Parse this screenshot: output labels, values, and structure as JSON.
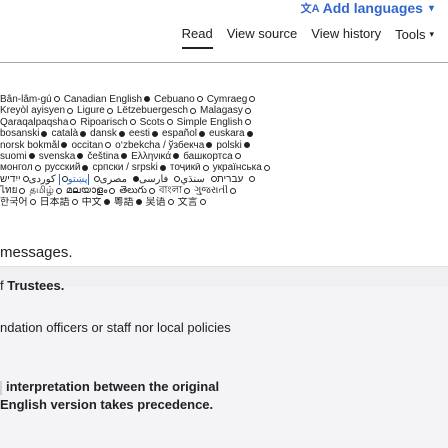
{
  "header": {
    "add_languages": "Add languages",
    "tabs": [
      {
        "label": "Read",
        "active": true
      },
      {
        "label": "View source",
        "active": false
      },
      {
        "label": "View history",
        "active": false
      },
      {
        "label": "Tools",
        "active": false
      }
    ]
  },
  "languages_rows": [
    [
      {
        "name": "Bân-lâm-gú",
        "dot": "open"
      },
      {
        "name": "Canadian English",
        "dot": "filled"
      },
      {
        "name": "Cebuano",
        "dot": "open"
      },
      {
        "name": "Cymraeg",
        "dot": "open"
      }
    ],
    [
      {
        "name": "Kreyòl ayisyen",
        "dot": "open"
      },
      {
        "name": "Ligure",
        "dot": "open"
      },
      {
        "name": "Lëtzebuergesch",
        "dot": "open"
      },
      {
        "name": "Malagasy",
        "dot": "open"
      }
    ],
    [
      {
        "name": "Qaraqalpaqsha",
        "dot": "open"
      },
      {
        "name": "Ripoarisch",
        "dot": "open"
      },
      {
        "name": "Scots",
        "dot": "open"
      },
      {
        "name": "Simple English",
        "dot": "open"
      }
    ],
    [
      {
        "name": "bosanski",
        "dot": "filled"
      },
      {
        "name": "català",
        "dot": "filled"
      },
      {
        "name": "dansk",
        "dot": "filled"
      },
      {
        "name": "eesti",
        "dot": "filled"
      },
      {
        "name": "español",
        "dot": "filled"
      },
      {
        "name": "euskara",
        "dot": "filled"
      }
    ],
    [
      {
        "name": "norsk bokmål",
        "dot": "filled"
      },
      {
        "name": "occitan",
        "dot": "open"
      },
      {
        "name": "o‘zbekcha / ўзбекча",
        "dot": "filled"
      },
      {
        "name": "polski",
        "dot": "filled"
      }
    ],
    [
      {
        "name": "suomi",
        "dot": "filled"
      },
      {
        "name": "svenska",
        "dot": "filled"
      },
      {
        "name": "čeština",
        "dot": "filled"
      },
      {
        "name": "Ελληνικά",
        "dot": "filled"
      },
      {
        "name": "башкортса",
        "dot": "open"
      }
    ],
    [
      {
        "name": "монгол",
        "dot": "open"
      },
      {
        "name": "русский",
        "dot": "filled"
      },
      {
        "name": "српски / srpski",
        "dot": "filled"
      },
      {
        "name": "тоҷикӣ",
        "dot": "open"
      },
      {
        "name": "українська",
        "dot": "open"
      }
    ],
    [
      {
        "name": "עברית",
        "dot": "open"
      },
      {
        "name": "سنڌي",
        "dot": "open"
      },
      {
        "name": "فارسی",
        "dot": "filled"
      },
      {
        "name": "مصرى",
        "dot": "open"
      },
      {
        "name": "پښتو",
        "dot": "open",
        "boxed": true
      },
      {
        "name": "كوردی",
        "dot": "open"
      },
      {
        "name": "ייִדיש",
        "dot": "open"
      }
    ],
    [
      {
        "name": "ไทย",
        "dot": "open"
      },
      {
        "name": "தமிழ்",
        "dot": "open"
      },
      {
        "name": "മലയാളം",
        "dot": "open"
      },
      {
        "name": "తెలుగు",
        "dot": "open"
      },
      {
        "name": "বাংলা",
        "dot": "open"
      },
      {
        "name": "ગુજરાતી",
        "dot": "open"
      }
    ],
    [
      {
        "name": "한국어",
        "dot": "open"
      },
      {
        "name": "日本語",
        "dot": "open"
      },
      {
        "name": "中文",
        "dot": "filled"
      },
      {
        "name": "粵語",
        "dot": "filled"
      },
      {
        "name": "吴语",
        "dot": "open"
      },
      {
        "name": "文言",
        "dot": "open"
      }
    ]
  ],
  "messages_heading": "messages.",
  "panel": {
    "trustees_prefix": "f ",
    "trustees_bold": "Trustees.",
    "staff_text": "ndation officers or staff nor local policies",
    "interp_line1": "interpretation between the original",
    "interp_line2": "English version takes precedence."
  }
}
